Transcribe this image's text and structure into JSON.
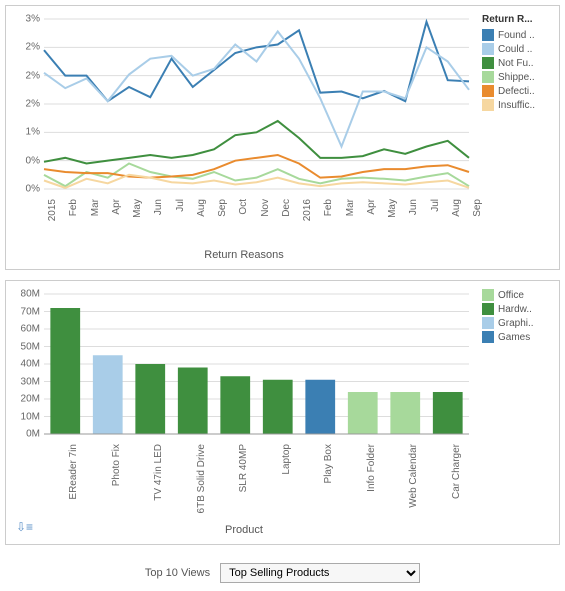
{
  "chart_data": [
    {
      "type": "line",
      "title": "Return Reasons",
      "xlabel": "Return Reasons",
      "ylabel": "",
      "ylim": [
        0,
        3
      ],
      "y_ticks": [
        "0%",
        "0%",
        "1%",
        "2%",
        "2%",
        "2%",
        "3%"
      ],
      "categories": [
        "2015",
        "Feb",
        "Mar",
        "Apr",
        "May",
        "Jun",
        "Jul",
        "Aug",
        "Sep",
        "Oct",
        "Nov",
        "Dec",
        "2016",
        "Feb",
        "Mar",
        "Apr",
        "May",
        "Jun",
        "Jul",
        "Aug",
        "Sep"
      ],
      "legend_title": "Return R...",
      "series": [
        {
          "name": "Found ..",
          "color": "#3b7fb3",
          "values": [
            2.45,
            2.0,
            2.0,
            1.55,
            1.8,
            1.62,
            2.3,
            1.8,
            2.1,
            2.4,
            2.5,
            2.55,
            2.8,
            1.7,
            1.72,
            1.6,
            1.73,
            1.55,
            2.95,
            1.92,
            1.9
          ]
        },
        {
          "name": "Could ..",
          "color": "#a9cde8",
          "values": [
            2.05,
            1.78,
            1.95,
            1.55,
            2.02,
            2.3,
            2.35,
            2.0,
            2.12,
            2.55,
            2.25,
            2.78,
            2.3,
            1.6,
            0.75,
            1.72,
            1.72,
            1.6,
            2.5,
            2.25,
            1.75
          ]
        },
        {
          "name": "Not Fu..",
          "color": "#3f8f3f",
          "values": [
            0.48,
            0.55,
            0.45,
            0.5,
            0.55,
            0.6,
            0.55,
            0.6,
            0.7,
            0.95,
            1.0,
            1.2,
            0.9,
            0.55,
            0.55,
            0.58,
            0.7,
            0.62,
            0.75,
            0.85,
            0.55
          ]
        },
        {
          "name": "Shippe..",
          "color": "#a7d99b",
          "values": [
            0.25,
            0.05,
            0.3,
            0.2,
            0.45,
            0.3,
            0.22,
            0.18,
            0.3,
            0.15,
            0.2,
            0.35,
            0.18,
            0.1,
            0.18,
            0.2,
            0.18,
            0.15,
            0.22,
            0.28,
            0.05
          ]
        },
        {
          "name": "Defecti..",
          "color": "#e98b2e",
          "values": [
            0.35,
            0.3,
            0.28,
            0.28,
            0.22,
            0.2,
            0.22,
            0.25,
            0.35,
            0.5,
            0.55,
            0.6,
            0.45,
            0.2,
            0.22,
            0.3,
            0.35,
            0.35,
            0.4,
            0.42,
            0.3
          ]
        },
        {
          "name": "Insuffic..",
          "color": "#f6d7a0",
          "values": [
            0.15,
            0.02,
            0.18,
            0.1,
            0.25,
            0.2,
            0.12,
            0.1,
            0.15,
            0.08,
            0.12,
            0.2,
            0.1,
            0.05,
            0.1,
            0.12,
            0.1,
            0.08,
            0.12,
            0.15,
            0.02
          ]
        }
      ]
    },
    {
      "type": "bar",
      "title": "Product",
      "xlabel": "Product",
      "ylabel": "",
      "ylim": [
        0,
        80
      ],
      "y_ticks": [
        "0M",
        "10M",
        "20M",
        "30M",
        "40M",
        "50M",
        "60M",
        "70M",
        "80M"
      ],
      "categories": [
        "EReader 7in",
        "Photo Fix",
        "TV 47in LED",
        "6TB Solid Drive",
        "SLR 40MP",
        "Laptop",
        "Play Box",
        "Info Folder",
        "Web Calendar",
        "Car Charger"
      ],
      "legend_title": "",
      "legend": [
        {
          "name": "Office",
          "color": "#a7d99b"
        },
        {
          "name": "Hardw..",
          "color": "#3f8f3f"
        },
        {
          "name": "Graphi..",
          "color": "#a9cde8"
        },
        {
          "name": "Games",
          "color": "#3b7fb3"
        }
      ],
      "bars": [
        {
          "label": "EReader 7in",
          "value": 72,
          "color": "#3f8f3f"
        },
        {
          "label": "Photo Fix",
          "value": 45,
          "color": "#a9cde8"
        },
        {
          "label": "TV 47in LED",
          "value": 40,
          "color": "#3f8f3f"
        },
        {
          "label": "6TB Solid Drive",
          "value": 38,
          "color": "#3f8f3f"
        },
        {
          "label": "SLR 40MP",
          "value": 33,
          "color": "#3f8f3f"
        },
        {
          "label": "Laptop",
          "value": 31,
          "color": "#3f8f3f"
        },
        {
          "label": "Play Box",
          "value": 31,
          "color": "#3b7fb3"
        },
        {
          "label": "Info Folder",
          "value": 24,
          "color": "#a7d99b"
        },
        {
          "label": "Web Calendar",
          "value": 24,
          "color": "#a7d99b"
        },
        {
          "label": "Car Charger",
          "value": 24,
          "color": "#3f8f3f"
        }
      ]
    }
  ],
  "footer": {
    "label": "Top 10 Views",
    "selected": "Top Selling Products"
  }
}
